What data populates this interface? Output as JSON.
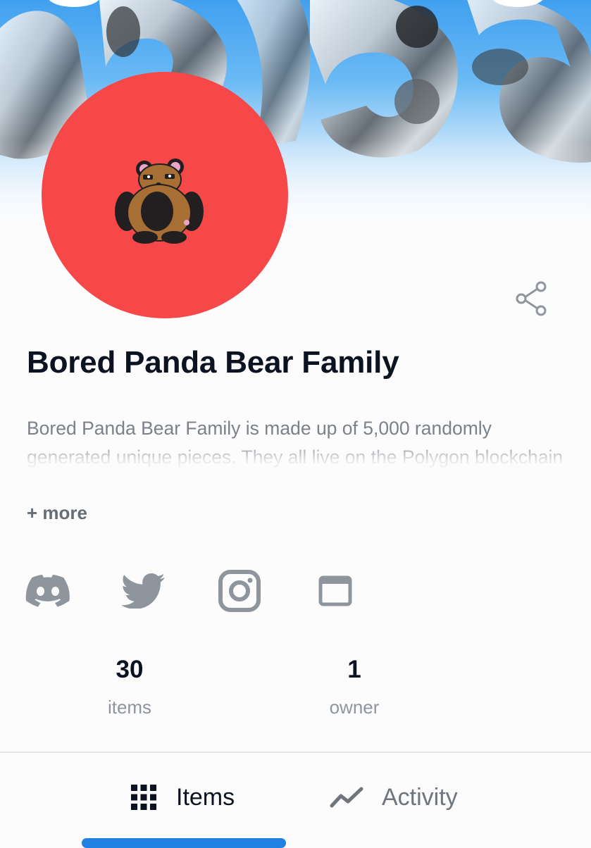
{
  "collection": {
    "name": "Bored Panda Bear Family",
    "description": "Bored Panda Bear Family is made up of 5,000 randomly generated unique pieces. They all live on the Polygon blockchain and this is where the family begins.",
    "more_label": "+ more"
  },
  "banner": {
    "icon": "banner-art"
  },
  "avatar": {
    "icon": "panda-bear-avatar",
    "background": "#f64848"
  },
  "actions": {
    "share_icon": "share-icon"
  },
  "social": [
    {
      "name": "discord",
      "icon": "discord-icon"
    },
    {
      "name": "twitter",
      "icon": "twitter-icon"
    },
    {
      "name": "instagram",
      "icon": "instagram-icon"
    },
    {
      "name": "website",
      "icon": "website-icon"
    }
  ],
  "stats": [
    {
      "value": "30",
      "label": "items"
    },
    {
      "value": "1",
      "label": "owner"
    }
  ],
  "tabs": [
    {
      "label": "Items",
      "icon": "grid-icon",
      "active": true
    },
    {
      "label": "Activity",
      "icon": "activity-icon",
      "active": false
    }
  ],
  "colors": {
    "accent": "#2081e2",
    "avatar_red": "#f64848",
    "text_primary": "#0b1220",
    "text_muted": "#8e959d"
  }
}
